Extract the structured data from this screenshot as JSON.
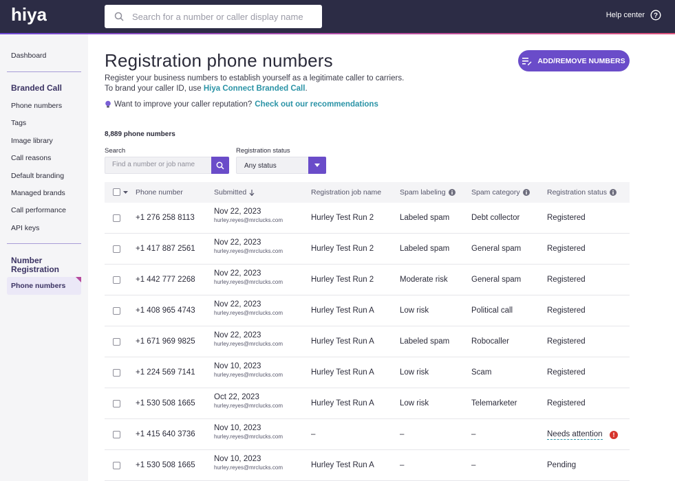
{
  "header": {
    "logo_text": "hiya",
    "search_placeholder": "Search for a number or caller display name",
    "help_label": "Help center"
  },
  "sidebar": {
    "dashboard": "Dashboard",
    "branded_call_heading": "Branded Call",
    "branded_items": [
      "Phone numbers",
      "Tags",
      "Image library",
      "Call reasons",
      "Default branding",
      "Managed brands",
      "Call performance",
      "API keys"
    ],
    "number_registration_heading_1": "Number",
    "number_registration_heading_2": "Registration",
    "active_item": "Phone numbers"
  },
  "main": {
    "title": "Registration phone numbers",
    "description": "Register your business numbers to establish yourself as a legitimate caller to carriers. To brand your caller ID, use",
    "description_link": "Hiya Connect Branded Call",
    "description_end": ".",
    "tip_text": "Want to improve your caller reputation?",
    "tip_link": "Check out our recommendations",
    "add_button": "ADD/REMOVE NUMBERS",
    "count": "8,889 phone numbers",
    "search_label": "Search",
    "search_placeholder": "Find a number or job name",
    "status_label": "Registration status",
    "status_value": "Any status"
  },
  "table": {
    "columns": {
      "phone": "Phone number",
      "submitted": "Submitted",
      "job": "Registration job name",
      "spam_label": "Spam labeling",
      "spam_cat": "Spam category",
      "status": "Registration status"
    },
    "rows": [
      {
        "phone": "+1 276 258 8113",
        "date": "Nov 22, 2023",
        "email": "hurley.reyes@mrclucks.com",
        "job": "Hurley Test Run 2",
        "spam_label": "Labeled spam",
        "spam_cat": "Debt collector",
        "status": "Registered"
      },
      {
        "phone": "+1 417 887 2561",
        "date": "Nov 22, 2023",
        "email": "hurley.reyes@mrclucks.com",
        "job": "Hurley Test Run 2",
        "spam_label": "Labeled spam",
        "spam_cat": "General spam",
        "status": "Registered"
      },
      {
        "phone": "+1 442 777 2268",
        "date": "Nov 22, 2023",
        "email": "hurley.reyes@mrclucks.com",
        "job": "Hurley Test Run 2",
        "spam_label": "Moderate risk",
        "spam_cat": "General spam",
        "status": "Registered"
      },
      {
        "phone": "+1 408 965 4743",
        "date": "Nov 22, 2023",
        "email": "hurley.reyes@mrclucks.com",
        "job": "Hurley Test Run A",
        "spam_label": "Low risk",
        "spam_cat": "Political call",
        "status": "Registered"
      },
      {
        "phone": "+1 671 969 9825",
        "date": "Nov 22, 2023",
        "email": "hurley.reyes@mrclucks.com",
        "job": "Hurley Test Run A",
        "spam_label": "Labeled spam",
        "spam_cat": "Robocaller",
        "status": "Registered"
      },
      {
        "phone": "+1 224 569 7141",
        "date": "Nov 10, 2023",
        "email": "hurley.reyes@mrclucks.com",
        "job": "Hurley Test Run A",
        "spam_label": "Low risk",
        "spam_cat": "Scam",
        "status": "Registered"
      },
      {
        "phone": "+1 530 508 1665",
        "date": "Oct 22, 2023",
        "email": "hurley.reyes@mrclucks.com",
        "job": "Hurley Test Run A",
        "spam_label": "Low risk",
        "spam_cat": "Telemarketer",
        "status": "Registered"
      },
      {
        "phone": "+1 415 640 3736",
        "date": "Nov 10, 2023",
        "email": "hurley.reyes@mrclucks.com",
        "job": "–",
        "spam_label": "–",
        "spam_cat": "–",
        "status": "Needs attention"
      },
      {
        "phone": "+1 530 508 1665",
        "date": "Nov 10, 2023",
        "email": "hurley.reyes@mrclucks.com",
        "job": "Hurley Test Run A",
        "spam_label": "–",
        "spam_cat": "–",
        "status": "Pending"
      }
    ]
  },
  "colors": {
    "topbar": "#2c2c45",
    "accent": "#6a4cc9",
    "link": "#2a93a6",
    "alert": "#d6342c"
  }
}
